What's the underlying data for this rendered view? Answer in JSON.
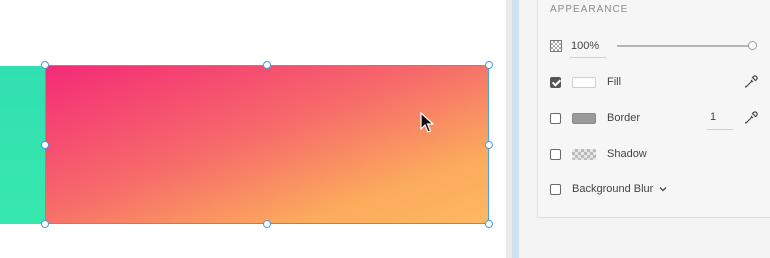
{
  "panel": {
    "section_title": "APPEARANCE",
    "opacity": {
      "value_label": "100%",
      "level": 1.0,
      "icon": "opacity-checker-icon"
    },
    "fill": {
      "label": "Fill",
      "checked": true,
      "color": "#ffffff",
      "icon": "eyedropper-icon"
    },
    "border": {
      "label": "Border",
      "checked": false,
      "color": "#9b9b9b",
      "width_value": "1",
      "icon": "eyedropper-icon"
    },
    "shadow": {
      "label": "Shadow",
      "checked": false
    },
    "background_blur": {
      "label": "Background Blur",
      "checked": false,
      "icon": "chevron-down-icon"
    }
  },
  "canvas": {
    "selected_shape_gradient": [
      "#f42a77",
      "#feb862"
    ],
    "adjacent_shape_color": "#33e3b0",
    "selection_color": "#4a9de6"
  }
}
